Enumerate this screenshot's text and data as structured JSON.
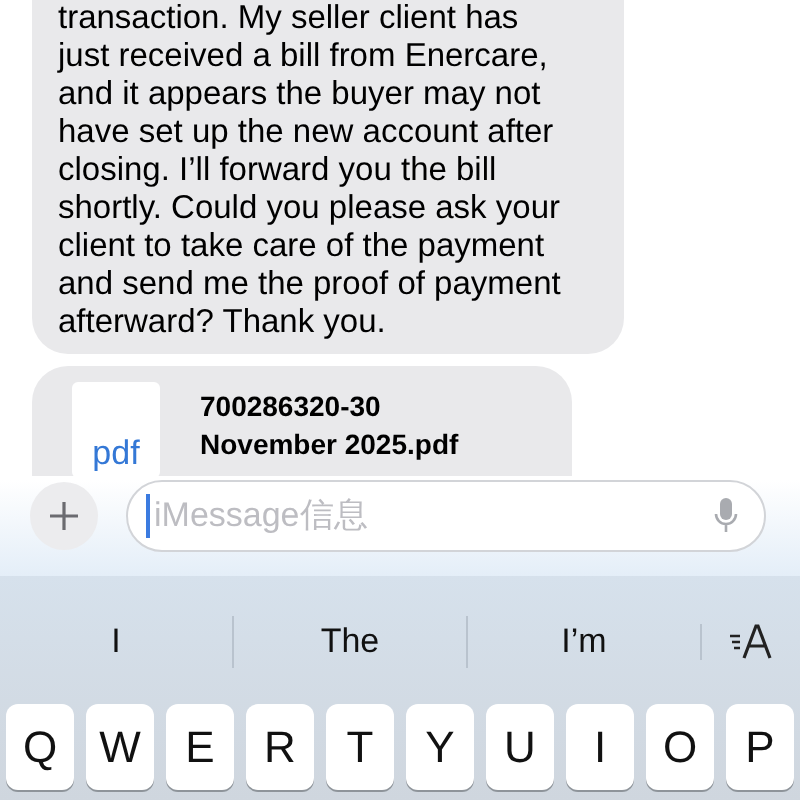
{
  "message": {
    "lines": [
      "transaction. My seller client has",
      "just received a bill from Enercare,",
      "and it appears the buyer may not",
      "have set up the new account after",
      "closing. I’ll forward you the bill",
      "shortly. Could you please ask your",
      "client to take care of the payment",
      "and send me the proof of payment",
      "afterward? Thank you."
    ]
  },
  "attachment": {
    "type_label": "pdf",
    "lines": [
      "700286320-30",
      "November 2025.pdf"
    ]
  },
  "composer": {
    "placeholder": "iMessage信息"
  },
  "suggestions": [
    "I",
    "The",
    "I’m"
  ],
  "keys": [
    "Q",
    "W",
    "E",
    "R",
    "T",
    "Y",
    "U",
    "I",
    "O",
    "P"
  ]
}
